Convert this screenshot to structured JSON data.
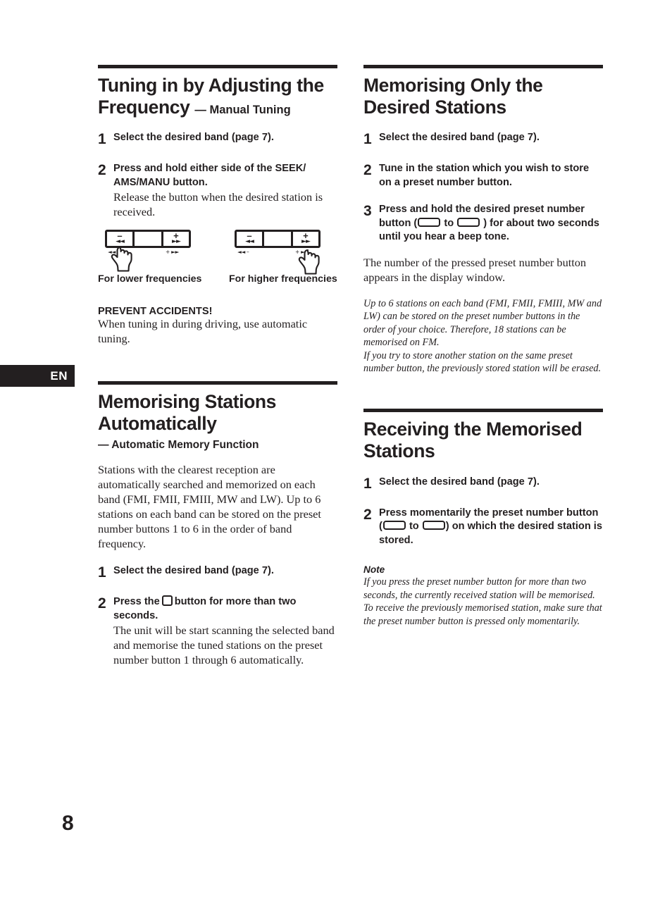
{
  "page": {
    "language_tab": "EN",
    "folio": "8"
  },
  "left_column": {
    "section_1": {
      "title_main": "Tuning in by Adjusting the Frequency",
      "title_sub": "— Manual Tuning",
      "steps": [
        {
          "num": "1",
          "lead": "Select the desired band (page 7).",
          "detail": ""
        },
        {
          "num": "2",
          "lead": "Press and hold either side of the SEEK/ AMS/MANU button.",
          "detail": "Release the button when the desired station is received."
        }
      ],
      "figures": [
        {
          "caption": "For lower frequencies",
          "left_sign": "–",
          "left_arrow": "◄◄",
          "right_sign": "+",
          "right_arrow": "►►",
          "sub_left": "◄◄ –",
          "sub_right": "+ ►►"
        },
        {
          "caption": "For higher frequencies",
          "left_sign": "–",
          "left_arrow": "◄◄",
          "right_sign": "+",
          "right_arrow": "►►",
          "sub_left": "◄◄ –",
          "sub_right": "+ ►►"
        }
      ],
      "caution_head": "PREVENT ACCIDENTS!",
      "caution_body": "When tuning in during driving, use automatic tuning."
    },
    "section_2": {
      "title_main": "Memorising Stations Automatically",
      "title_sub": "— Automatic Memory Function",
      "intro": "Stations with the clearest reception are automatically searched and memorized on each band (FMI, FMII, FMIII, MW and LW). Up to 6 stations on each band can be stored on the preset number buttons 1 to 6 in the order of band frequency.",
      "steps": [
        {
          "num": "1",
          "lead": "Select the desired band (page 7).",
          "detail": ""
        },
        {
          "num": "2",
          "lead_part1": "Press the",
          "lead_part2": "button for more than two seconds.",
          "detail": "The unit will be start scanning the selected band and memorise the tuned stations on the preset number button 1 through 6 automatically."
        }
      ]
    }
  },
  "right_column": {
    "section_1": {
      "title_main": "Memorising Only the Desired Stations",
      "steps": [
        {
          "num": "1",
          "lead": "Select the desired band (page 7)."
        },
        {
          "num": "2",
          "lead": "Tune in the station which you wish to store on a preset number button."
        },
        {
          "num": "3",
          "lead_part1": "Press and hold the desired preset number button (",
          "lead_part2": "to",
          "lead_part3": ") for about two seconds until you hear a beep tone."
        }
      ],
      "body": "The number of the pressed preset number button appears in the display window.",
      "italic_1": "Up to 6 stations on each band (FMI, FMII, FMIII, MW and LW) can be stored on the preset number buttons in the order of your choice. Therefore, 18 stations can be memorised on FM.",
      "italic_2": "If you try to store another station on the same preset number button, the previously stored station will be erased."
    },
    "section_2": {
      "title_main": "Receiving the Memorised Stations",
      "steps": [
        {
          "num": "1",
          "lead": "Select the desired band (page 7)."
        },
        {
          "num": "2",
          "lead_part1": "Press momentarily the preset number button (",
          "lead_part2": "to",
          "lead_part3": ") on which the desired station is stored."
        }
      ],
      "note_head": "Note",
      "note_body": "If you press the preset number button for more than two seconds, the currently received station will be memorised. To receive the previously memorised station, make sure that the preset number button is pressed only momentarily."
    }
  },
  "colors": {
    "ink": "#231f20",
    "paper": "#ffffff"
  }
}
